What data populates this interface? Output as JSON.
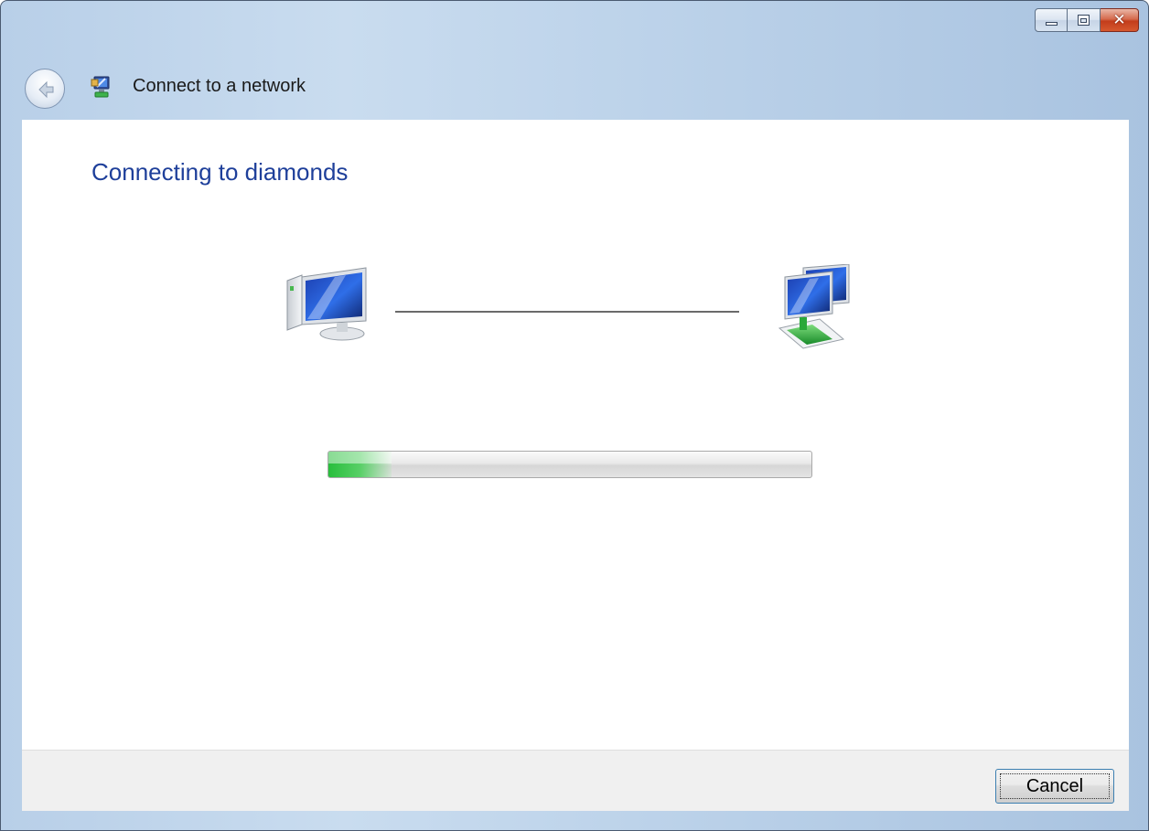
{
  "window": {
    "title": "Connect to a network",
    "caption_buttons": {
      "minimize": "minimize",
      "maximize": "maximize",
      "close": "close"
    }
  },
  "main": {
    "heading": "Connecting to diamonds",
    "progress": {
      "value": 0.13,
      "color": "#3ec24f"
    }
  },
  "footer": {
    "cancel_label": "Cancel"
  },
  "icons": {
    "back": "back-arrow-icon",
    "title": "network-connect-icon",
    "local_computer": "computer-icon",
    "network": "network-icon"
  },
  "colors": {
    "heading": "#1e3f9a",
    "frame": "#bdd3ea",
    "footer": "#f0f0f0"
  }
}
